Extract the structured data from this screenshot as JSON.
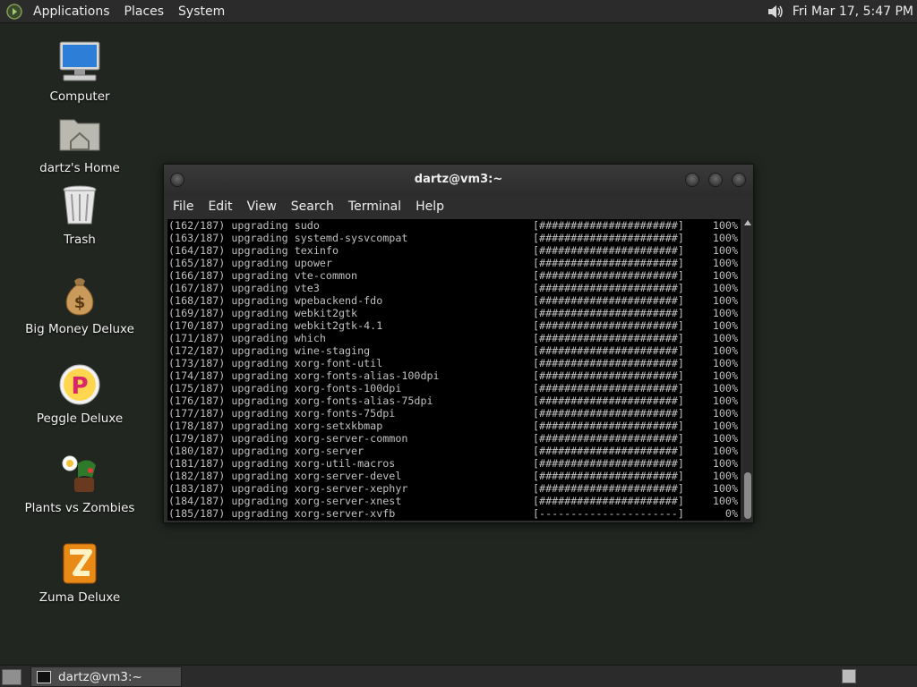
{
  "top_panel": {
    "menus": [
      "Applications",
      "Places",
      "System"
    ],
    "clock": "Fri Mar 17,  5:47 PM",
    "icons": {
      "logo": "gnome-foot-icon",
      "volume": "speaker-icon"
    }
  },
  "desktop_icons": [
    {
      "label": "Computer",
      "icon": "computer-icon"
    },
    {
      "label": "dartz's Home",
      "icon": "home-folder-icon"
    },
    {
      "label": "Trash",
      "icon": "trash-icon"
    },
    {
      "label": "Big Money Deluxe",
      "icon": "money-bag-icon"
    },
    {
      "label": "Peggle Deluxe",
      "icon": "peggle-icon"
    },
    {
      "label": "Plants vs Zombies",
      "icon": "plants-vs-zombies-icon"
    },
    {
      "label": "Zuma Deluxe",
      "icon": "zuma-icon"
    }
  ],
  "terminal": {
    "title": "dartz@vm3:~",
    "menu": [
      "File",
      "Edit",
      "View",
      "Search",
      "Terminal",
      "Help"
    ],
    "lines": [
      {
        "text": "(162/187) upgrading sudo",
        "bar": "[######################]",
        "pct": "100%"
      },
      {
        "text": "(163/187) upgrading systemd-sysvcompat",
        "bar": "[######################]",
        "pct": "100%"
      },
      {
        "text": "(164/187) upgrading texinfo",
        "bar": "[######################]",
        "pct": "100%"
      },
      {
        "text": "(165/187) upgrading upower",
        "bar": "[######################]",
        "pct": "100%"
      },
      {
        "text": "(166/187) upgrading vte-common",
        "bar": "[######################]",
        "pct": "100%"
      },
      {
        "text": "(167/187) upgrading vte3",
        "bar": "[######################]",
        "pct": "100%"
      },
      {
        "text": "(168/187) upgrading wpebackend-fdo",
        "bar": "[######################]",
        "pct": "100%"
      },
      {
        "text": "(169/187) upgrading webkit2gtk",
        "bar": "[######################]",
        "pct": "100%"
      },
      {
        "text": "(170/187) upgrading webkit2gtk-4.1",
        "bar": "[######################]",
        "pct": "100%"
      },
      {
        "text": "(171/187) upgrading which",
        "bar": "[######################]",
        "pct": "100%"
      },
      {
        "text": "(172/187) upgrading wine-staging",
        "bar": "[######################]",
        "pct": "100%"
      },
      {
        "text": "(173/187) upgrading xorg-font-util",
        "bar": "[######################]",
        "pct": "100%"
      },
      {
        "text": "(174/187) upgrading xorg-fonts-alias-100dpi",
        "bar": "[######################]",
        "pct": "100%"
      },
      {
        "text": "(175/187) upgrading xorg-fonts-100dpi",
        "bar": "[######################]",
        "pct": "100%"
      },
      {
        "text": "(176/187) upgrading xorg-fonts-alias-75dpi",
        "bar": "[######################]",
        "pct": "100%"
      },
      {
        "text": "(177/187) upgrading xorg-fonts-75dpi",
        "bar": "[######################]",
        "pct": "100%"
      },
      {
        "text": "(178/187) upgrading xorg-setxkbmap",
        "bar": "[######################]",
        "pct": "100%"
      },
      {
        "text": "(179/187) upgrading xorg-server-common",
        "bar": "[######################]",
        "pct": "100%"
      },
      {
        "text": "(180/187) upgrading xorg-server",
        "bar": "[######################]",
        "pct": "100%"
      },
      {
        "text": "(181/187) upgrading xorg-util-macros",
        "bar": "[######################]",
        "pct": "100%"
      },
      {
        "text": "(182/187) upgrading xorg-server-devel",
        "bar": "[######################]",
        "pct": "100%"
      },
      {
        "text": "(183/187) upgrading xorg-server-xephyr",
        "bar": "[######################]",
        "pct": "100%"
      },
      {
        "text": "(184/187) upgrading xorg-server-xnest",
        "bar": "[######################]",
        "pct": "100%"
      },
      {
        "text": "(185/187) upgrading xorg-server-xvfb",
        "bar": "[----------------------]",
        "pct": "0%"
      }
    ]
  },
  "taskbar": {
    "task_label": "dartz@vm3:~"
  },
  "colors": {
    "desktop_bg": "#222621",
    "panel_bg": "#2b2b2b",
    "terminal_bg": "#000000",
    "terminal_fg": "#c0c0c0"
  }
}
